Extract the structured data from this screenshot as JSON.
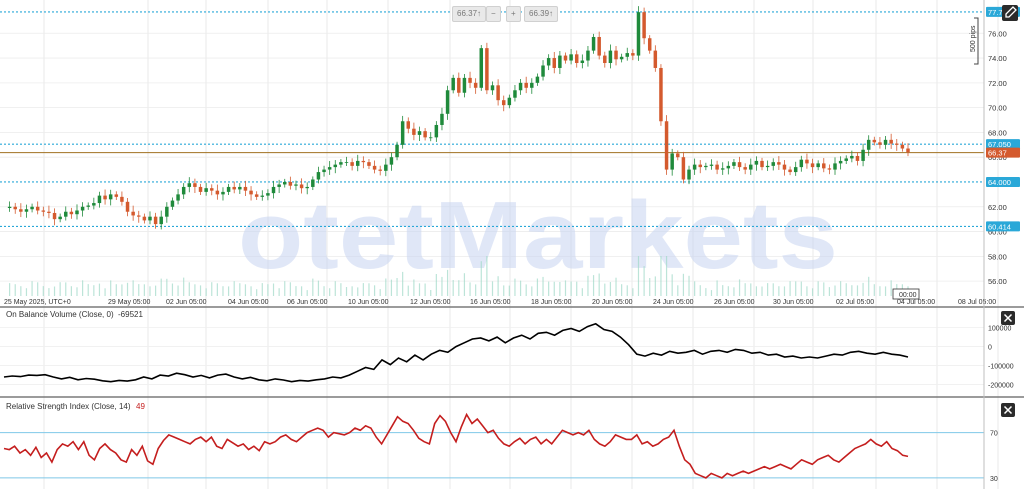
{
  "header": {
    "bid": "66.37",
    "bid_suffix": "↑",
    "ask": "66.39",
    "ask_suffix": "↑",
    "minus": "−",
    "plus": "+"
  },
  "watermark": {
    "text": "otetMarkets"
  },
  "colors": {
    "up": "#1f8a3b",
    "down": "#d45a2e",
    "level": "#2aa8d8",
    "price_line": "#a07020",
    "obv": "#000000",
    "rsi": "#c41e1e",
    "rsi_band": "#7fc8e8"
  },
  "icons": {
    "corner": "edit-icon",
    "close": "close-icon"
  },
  "chart_data": [
    {
      "type": "candlestick",
      "title": "",
      "x_ticks": [
        "25 May 2025, UTC+0",
        "29 May 05:00",
        "02 Jun 05:00",
        "04 Jun 05:00",
        "06 Jun 05:00",
        "10 Jun 05:00",
        "12 Jun 05:00",
        "16 Jun 05:00",
        "18 Jun 05:00",
        "20 Jun 05:00",
        "24 Jun 05:00",
        "26 Jun 05:00",
        "30 Jun 05:00",
        "02 Jul 05:00",
        "04 Jul 05:00",
        "08 Jul 05:00"
      ],
      "cursor_label": "00:00",
      "y_ticks": [
        "76.00",
        "74.00",
        "72.00",
        "70.00",
        "68.00",
        "66.00",
        "62.00",
        "60.00",
        "58.00",
        "56.00"
      ],
      "ylim": [
        54.8,
        78.2
      ],
      "levels": [
        {
          "value": 77.721,
          "label": "77.721"
        },
        {
          "value": 67.05,
          "label": "67.050"
        },
        {
          "value": 64.0,
          "label": "64.000"
        },
        {
          "value": 60.414,
          "label": "60.414"
        }
      ],
      "current_price": {
        "value": 66.37,
        "label": "66.37"
      },
      "pips_label": "500 pips",
      "close": [
        61.9,
        62.0,
        61.8,
        61.6,
        61.8,
        62.0,
        61.7,
        61.6,
        61.5,
        61.0,
        61.2,
        61.6,
        61.4,
        61.7,
        62.0,
        62.1,
        62.3,
        62.9,
        62.6,
        63.0,
        62.8,
        62.4,
        61.6,
        61.3,
        61.2,
        60.9,
        61.2,
        60.6,
        61.2,
        62.0,
        62.5,
        63.0,
        63.6,
        63.9,
        63.6,
        63.2,
        63.5,
        63.3,
        63.0,
        63.2,
        63.6,
        63.4,
        63.6,
        63.3,
        63.0,
        62.8,
        62.9,
        63.1,
        63.6,
        63.8,
        64.0,
        63.7,
        63.8,
        63.5,
        63.6,
        64.2,
        64.8,
        65.0,
        65.2,
        65.4,
        65.6,
        65.6,
        65.3,
        65.7,
        65.6,
        65.3,
        65.0,
        64.9,
        65.4,
        66.0,
        67.0,
        68.9,
        68.3,
        67.8,
        68.1,
        67.6,
        67.6,
        68.6,
        69.5,
        71.4,
        72.4,
        71.2,
        72.4,
        72.0,
        71.6,
        74.8,
        71.4,
        71.8,
        70.6,
        70.2,
        70.8,
        71.4,
        72.0,
        71.6,
        72.0,
        72.5,
        73.4,
        74.0,
        73.2,
        74.2,
        73.8,
        74.3,
        73.6,
        73.8,
        74.6,
        75.7,
        74.2,
        73.6,
        74.6,
        73.9,
        74.1,
        74.4,
        74.2,
        77.7,
        75.6,
        74.6,
        73.2,
        68.9,
        65.0,
        66.3,
        66.0,
        64.2,
        65.0,
        65.4,
        65.2,
        65.3,
        65.4,
        65.0,
        65.1,
        65.3,
        65.6,
        65.2,
        65.0,
        65.4,
        65.7,
        65.2,
        65.3,
        65.6,
        65.4,
        65.0,
        64.8,
        65.2,
        65.8,
        65.5,
        65.2,
        65.5,
        65.1,
        65.0,
        65.5,
        65.7,
        65.9,
        66.1,
        65.7,
        66.6,
        67.4,
        67.2,
        67.0,
        67.4,
        67.1,
        67.0,
        66.7,
        66.4
      ]
    },
    {
      "type": "line",
      "title": "On Balance Volume (Close, 0)",
      "value_label": "-69521",
      "y_ticks": [
        "100000",
        "0",
        "-100000",
        "-200000"
      ],
      "ylim": [
        -255000,
        140000
      ],
      "values": [
        -160000,
        -155000,
        -158000,
        -150000,
        -152000,
        -148000,
        -160000,
        -170000,
        -162000,
        -175000,
        -168000,
        -172000,
        -180000,
        -185000,
        -178000,
        -182000,
        -175000,
        -160000,
        -170000,
        -150000,
        -155000,
        -140000,
        -148000,
        -160000,
        -152000,
        -165000,
        -150000,
        -145000,
        -160000,
        -170000,
        -162000,
        -175000,
        -180000,
        -170000,
        -176000,
        -185000,
        -178000,
        -182000,
        -175000,
        -170000,
        -160000,
        -165000,
        -150000,
        -130000,
        -110000,
        -120000,
        -70000,
        -95000,
        -60000,
        -80000,
        -45000,
        -70000,
        -40000,
        -20000,
        -30000,
        0,
        20000,
        40000,
        45000,
        30000,
        50000,
        20000,
        45000,
        60000,
        40000,
        70000,
        75000,
        60000,
        85000,
        95000,
        80000,
        105000,
        120000,
        90000,
        80000,
        50000,
        10000,
        -40000,
        -50000,
        -35000,
        -45000,
        -25000,
        -35000,
        -30000,
        -20000,
        -40000,
        -25000,
        -20000,
        -30000,
        -15000,
        -20000,
        -35000,
        -30000,
        -45000,
        -40000,
        -55000,
        -50000,
        -60000,
        -55000,
        -60000,
        -50000,
        -40000,
        -45000,
        -30000,
        -25000,
        -35000,
        -40000,
        -30000,
        -40000,
        -45000,
        -55000
      ]
    },
    {
      "type": "line",
      "title": "Relative Strength Index (Close, 14)",
      "value_label": "49",
      "y_ticks": [
        "70",
        "30"
      ],
      "bands": [
        70,
        30
      ],
      "ylim": [
        22,
        97
      ],
      "values": [
        56,
        55,
        58,
        52,
        55,
        50,
        57,
        48,
        52,
        44,
        55,
        60,
        58,
        62,
        55,
        62,
        50,
        46,
        56,
        60,
        55,
        52,
        46,
        44,
        55,
        50,
        58,
        45,
        42,
        56,
        63,
        68,
        66,
        64,
        62,
        60,
        64,
        66,
        62,
        66,
        58,
        56,
        64,
        61,
        58,
        60,
        55,
        58,
        54,
        62,
        60,
        62,
        66,
        68,
        64,
        62,
        66,
        70,
        72,
        74,
        72,
        66,
        70,
        69,
        68,
        70,
        74,
        72,
        76,
        74,
        66,
        60,
        68,
        76,
        84,
        80,
        78,
        72,
        65,
        62,
        60,
        78,
        85,
        80,
        70,
        62,
        75,
        86,
        78,
        82,
        76,
        70,
        72,
        65,
        60,
        58,
        62,
        65,
        60,
        64,
        66,
        60,
        64,
        60,
        66,
        72,
        70,
        68,
        70,
        68,
        72,
        64,
        60,
        58,
        62,
        68,
        66,
        64,
        64,
        68,
        60,
        62,
        58,
        60,
        64,
        66,
        72,
        58,
        46,
        42,
        34,
        32,
        30,
        34,
        32,
        30,
        34,
        32,
        34,
        36,
        34,
        36,
        38,
        40,
        38,
        40,
        42,
        40,
        38,
        42,
        46,
        44,
        42,
        46,
        48,
        50,
        46,
        44,
        48,
        52,
        56,
        58,
        60,
        64,
        60,
        58,
        62,
        56,
        54,
        50,
        49
      ]
    }
  ]
}
